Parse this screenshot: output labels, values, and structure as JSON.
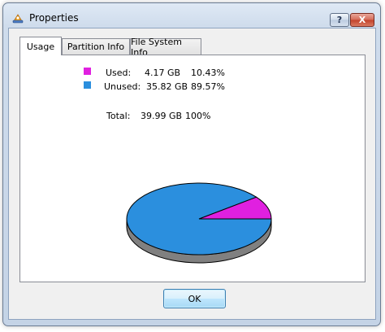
{
  "window": {
    "title": "Properties",
    "help_label": "?",
    "close_label": "X"
  },
  "tabs": [
    {
      "label": "Usage",
      "selected": true
    },
    {
      "label": "Partition Info",
      "selected": false
    },
    {
      "label": "File System Info",
      "selected": false
    }
  ],
  "usage": {
    "used": {
      "label": "Used:",
      "size": "4.17 GB",
      "percent": "10.43%",
      "color": "#e020e0"
    },
    "unused": {
      "label": "Unused:",
      "size": "35.82 GB",
      "percent": "89.57%",
      "color": "#2b8fde"
    },
    "total": {
      "label": "Total:",
      "size": "39.99 GB",
      "percent": "100%"
    }
  },
  "chart_data": {
    "type": "pie",
    "slices": [
      {
        "name": "Used",
        "value": 10.43,
        "color": "#e020e0"
      },
      {
        "name": "Unused",
        "value": 89.57,
        "color": "#2b8fde"
      }
    ]
  },
  "buttons": {
    "ok_label": "OK"
  }
}
